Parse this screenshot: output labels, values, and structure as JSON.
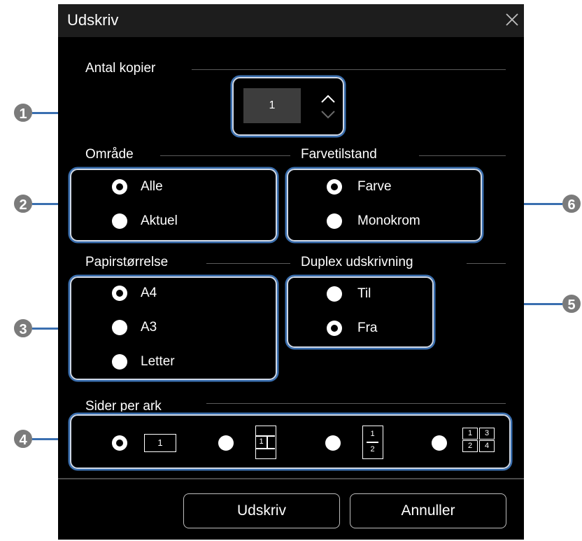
{
  "dialog": {
    "title": "Udskriv",
    "close_glyph": "×"
  },
  "copies": {
    "label": "Antal kopier",
    "value": "1"
  },
  "area": {
    "label": "Område",
    "options": [
      {
        "label": "Alle",
        "checked": true
      },
      {
        "label": "Aktuel",
        "checked": false
      }
    ]
  },
  "color_mode": {
    "label": "Farvetilstand",
    "options": [
      {
        "label": "Farve",
        "checked": true
      },
      {
        "label": "Monokrom",
        "checked": false
      }
    ]
  },
  "paper_size": {
    "label": "Papirstørrelse",
    "options": [
      {
        "label": "A4",
        "checked": true
      },
      {
        "label": "A3",
        "checked": false
      },
      {
        "label": "Letter",
        "checked": false
      }
    ]
  },
  "duplex": {
    "label": "Duplex udskrivning",
    "options": [
      {
        "label": "Til",
        "checked": false
      },
      {
        "label": "Fra",
        "checked": true
      }
    ]
  },
  "pages_per_sheet": {
    "label": "Sider per ark",
    "icon_digits": {
      "one": "1",
      "two_a": "1",
      "two_b": "2",
      "four_a": "1",
      "four_b": "3",
      "four_c": "2",
      "four_d": "4"
    },
    "selected": "1"
  },
  "buttons": {
    "print": "Udskriv",
    "cancel": "Annuller"
  },
  "callouts": [
    "1",
    "2",
    "3",
    "4",
    "5",
    "6"
  ],
  "colors": {
    "dialog_bg": "#000000",
    "highlight_border": "#3a6fb0",
    "callout_bg": "#7b7b7b"
  }
}
